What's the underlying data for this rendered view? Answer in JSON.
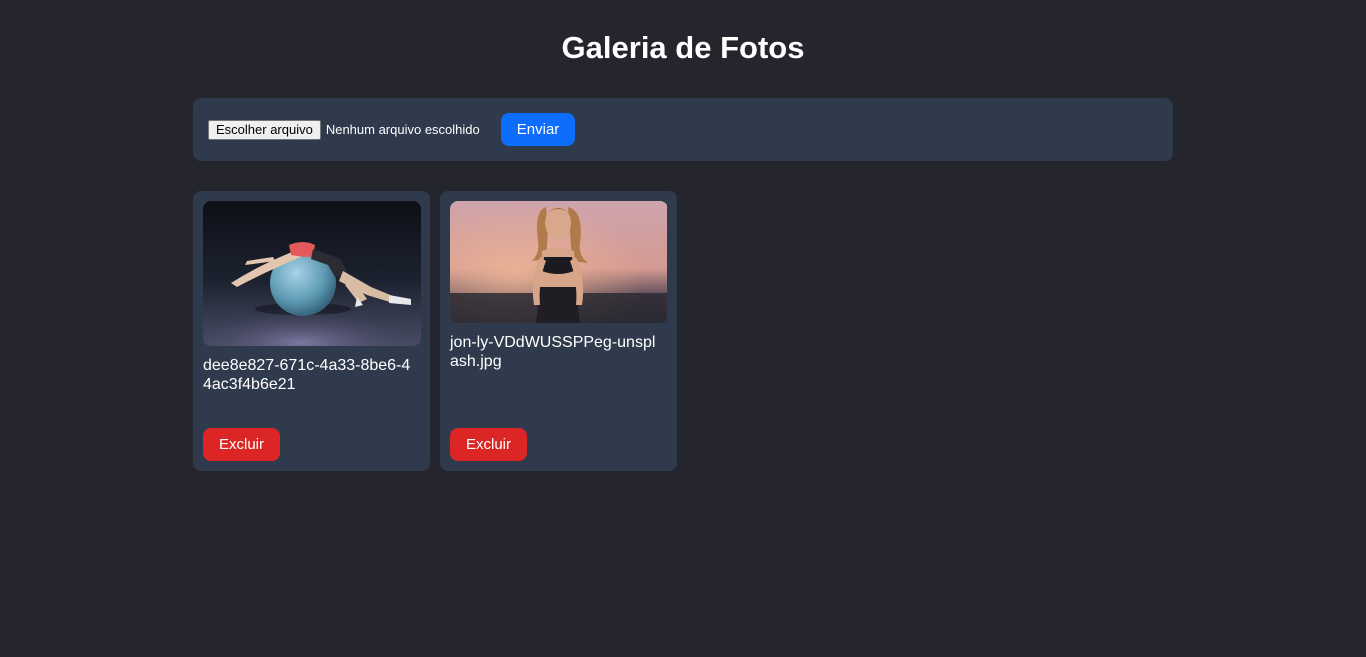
{
  "header": {
    "title": "Galeria de Fotos"
  },
  "upload": {
    "file_button_label": "Escolher arquivo",
    "file_status": "Nenhum arquivo escolhido",
    "submit_label": "Enviar"
  },
  "gallery": {
    "items": [
      {
        "caption": "dee8e827-671c-4a33-8be6-44ac3f4b6e21",
        "delete_label": "Excluir",
        "image_subject": "woman stretching backwards over an exercise ball"
      },
      {
        "caption": "jon-ly-VDdWUSSPPeg-unsplash.jpg",
        "delete_label": "Excluir",
        "image_subject": "woman in black sports top at sunset"
      }
    ]
  },
  "colors": {
    "background": "#25252d",
    "panel": "#2f3a4c",
    "primary": "#0d6efd",
    "danger": "#dc2626"
  }
}
